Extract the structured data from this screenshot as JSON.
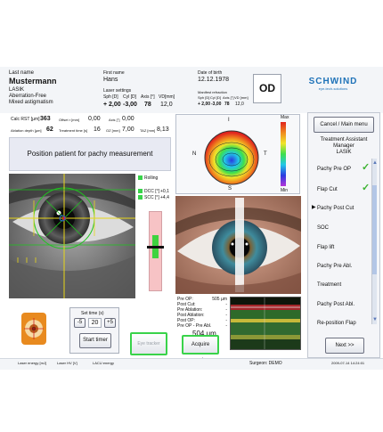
{
  "patient": {
    "last_name_label": "Last name",
    "last_name": "Mustermann",
    "first_name_label": "First name",
    "first_name": "Hans",
    "dob_label": "Date of birth",
    "dob": "12.12.1978",
    "procedure": "LASIK",
    "profile": "Aberration-Free",
    "condition": "Mixed astigmatism",
    "eye": "OD"
  },
  "laser_settings": {
    "title": "Laser settings",
    "headers": [
      "Sph [D]",
      "Cyl [D]",
      "Axis [°]",
      "VD[mm]"
    ],
    "values": [
      "+ 2,00",
      "-3,00",
      "78",
      "12,0"
    ]
  },
  "manifest": {
    "title": "Manifest refraction",
    "headers": [
      "Sph [D]",
      "Cyl [D]",
      "Axis [°]",
      "VD [mm]"
    ],
    "values": [
      "+ 2,00",
      "-3,00",
      "78",
      "12,0"
    ]
  },
  "logo": {
    "name": "SCHWIND",
    "tagline": "eye-tech-solutions",
    "color": "#1e72b8"
  },
  "params": {
    "calc_rst_label": "Calc RST [µm]",
    "calc_rst": "363",
    "offset_label": "Offset r [mm]",
    "offset": "0,00",
    "axis_label": "Axis [°]",
    "axis": "0,00",
    "ablation_label": "Ablation depth [µm]",
    "ablation": "62",
    "treat_time_label": "Treatment time [s]",
    "treat_time": "16",
    "oz_label": "OZ [mm]",
    "oz": "7,00",
    "taz_label": "TAZ [mm]",
    "taz": "8,13"
  },
  "instruction": "Position patient for pachy measurement",
  "map": {
    "top": "I",
    "left": "N",
    "right": "T",
    "bottom": "S",
    "scale_max": "Max",
    "scale_min": "Min"
  },
  "tracking": {
    "rolling": "Rolling",
    "dcc_label": "DCC [°]",
    "dcc": "+0,1",
    "scc_label": "SCC [°]",
    "scc": "+4,4"
  },
  "timer": {
    "label": "Set time (s)",
    "minus": "-5",
    "value": "20",
    "plus": "+5",
    "start": "Start timer"
  },
  "eye_tracker_label": "Eye tracker",
  "acquire_label": "Acquire pachy",
  "pachy_table": {
    "rows": [
      {
        "label": "Pre OP:",
        "value": "505 µm"
      },
      {
        "label": "Post Cut:",
        "value": "-"
      },
      {
        "label": "Pre Ablation:",
        "value": "-"
      },
      {
        "label": "Post Ablation:",
        "value": "-"
      },
      {
        "label": "Post OP:",
        "value": "-"
      },
      {
        "label": "Pre OP - Pre Abl.",
        "value": "-"
      }
    ],
    "current": "504 µm"
  },
  "sidebar": {
    "cancel_label": "Cancel / Main menu",
    "title_1": "Treatment Assistant",
    "title_2": "Manager",
    "title_3": "LASIK",
    "items": [
      {
        "label": "Pachy Pre OP",
        "done": true
      },
      {
        "label": "Flap Cut",
        "done": true
      },
      {
        "label": "Pachy Post Cut",
        "done": false,
        "current": true
      },
      {
        "label": "SOC",
        "done": false
      },
      {
        "label": "Flap lift",
        "done": false
      },
      {
        "label": "Pachy Pre Abl.",
        "done": false
      },
      {
        "label": "Treatment",
        "done": false
      },
      {
        "label": "Pachy Post Abl.",
        "done": false
      },
      {
        "label": "Re-position Flap",
        "done": false
      }
    ],
    "next_label": "Next >>"
  },
  "footer": {
    "laser_energy": "Laser energy [mJ]",
    "laser_hv": "Laser HV [V]",
    "lacu": "LACU energy",
    "surgeon": "Surgeon: DEMO",
    "datetime": "2009-07-14 14:24:01"
  },
  "colors": {
    "accent_green": "#39d34a",
    "check_green": "#3cb331",
    "panel_border": "#b9c0cc"
  }
}
